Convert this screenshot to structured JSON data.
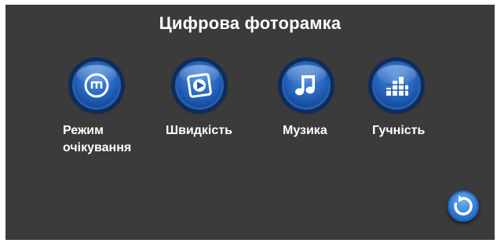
{
  "title": "Цифрова фоторамка",
  "menu": {
    "items": [
      {
        "label_line1": "Режим",
        "label_line2": "очікування",
        "icon": "standby-icon"
      },
      {
        "label_line1": "Швидкість",
        "label_line2": "",
        "icon": "slideshow-speed-icon"
      },
      {
        "label_line1": "Музика",
        "label_line2": "",
        "icon": "music-note-icon"
      },
      {
        "label_line1": "Гучність",
        "label_line2": "",
        "icon": "volume-bars-icon"
      }
    ]
  },
  "back_button": {
    "icon": "back-rotate-icon"
  },
  "colors": {
    "background": "#3b3b3b",
    "accent": "#2b74cf",
    "text": "#ffffff"
  }
}
